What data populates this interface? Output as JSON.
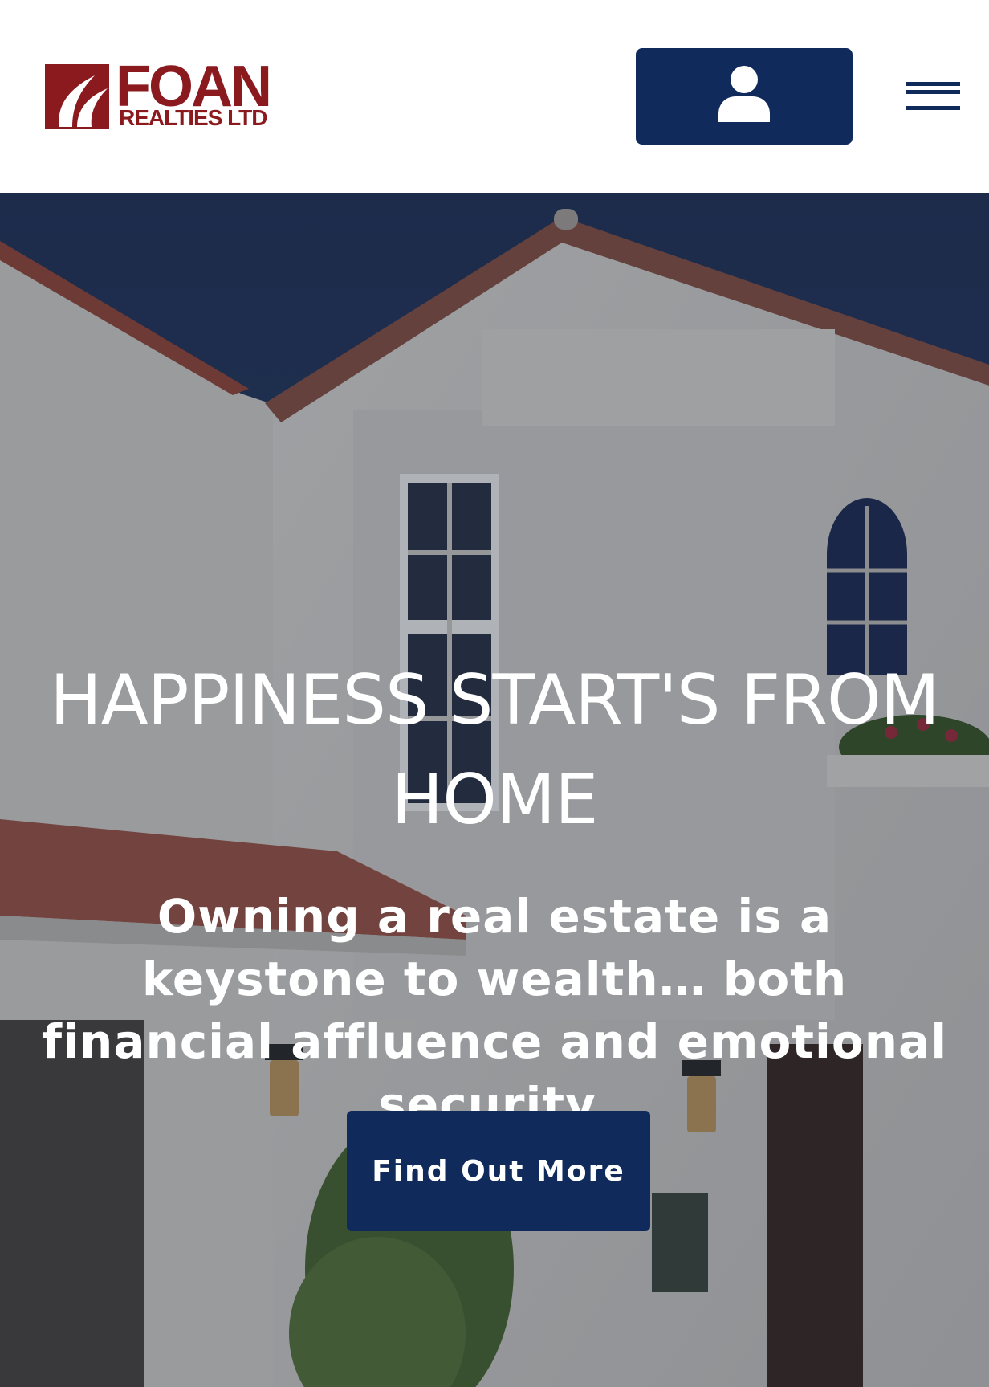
{
  "header": {
    "logo": {
      "name": "FOAN",
      "tagline": "REALTIES LTD"
    },
    "account_icon": "user-icon",
    "menu_icon": "hamburger-menu-icon"
  },
  "hero": {
    "title": "HAPPINESS START'S FROM HOME",
    "subtitle": "Owning a real estate is a keystone to wealth… both financial affluence and emotional security.",
    "cta_label": "Find Out More"
  },
  "colors": {
    "brand_red": "#8b1a1f",
    "navy": "#102a5c",
    "white": "#ffffff"
  }
}
